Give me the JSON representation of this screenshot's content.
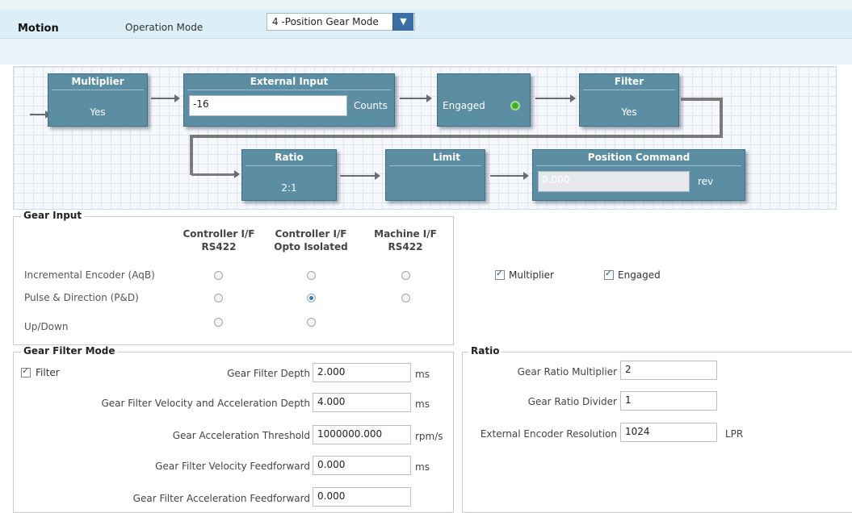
{
  "header": {
    "title": "Motion",
    "operation_mode_label": "Operation Mode",
    "operation_mode_value": "4 -Position Gear Mode"
  },
  "diagram": {
    "multiplier": {
      "title": "Multiplier",
      "value": "Yes"
    },
    "external_input": {
      "title": "External Input",
      "value": "-16",
      "unit": "Counts"
    },
    "engaged": {
      "label": "Engaged",
      "status_color": "#3fae2a"
    },
    "filter": {
      "title": "Filter",
      "value": "Yes"
    },
    "ratio": {
      "title": "Ratio",
      "value": "2:1"
    },
    "limit": {
      "title": "Limit"
    },
    "position_command": {
      "title": "Position Command",
      "value": "0.000",
      "unit": "rev"
    }
  },
  "gear_input": {
    "title": "Gear Input",
    "columns": [
      {
        "line1": "Controller I/F",
        "line2": "RS422"
      },
      {
        "line1": "Controller I/F",
        "line2": "Opto Isolated"
      },
      {
        "line1": "Machine I/F",
        "line2": "RS422"
      }
    ],
    "rows": [
      {
        "label": "Incremental Encoder (AqB)"
      },
      {
        "label": "Pulse & Direction (P&D)"
      },
      {
        "label": "Up/Down"
      }
    ],
    "selected": "Pulse & Direction (P&D) / Controller I/F Opto Isolated"
  },
  "checkboxes": {
    "multiplier": "Multiplier",
    "engaged": "Engaged"
  },
  "gear_filter_mode": {
    "title": "Gear Filter Mode",
    "filter_checkbox": "Filter",
    "fields": [
      {
        "label": "Gear Filter Depth",
        "value": "2.000",
        "unit": "ms"
      },
      {
        "label": "Gear Filter Velocity and Acceleration Depth",
        "value": "4.000",
        "unit": "ms"
      },
      {
        "label": "Gear Acceleration Threshold",
        "value": "1000000.000",
        "unit": "rpm/s"
      },
      {
        "label": "Gear Filter Velocity Feedforward",
        "value": "0.000",
        "unit": "ms"
      },
      {
        "label": "Gear Filter Acceleration Feedforward",
        "value": "0.000",
        "unit": ""
      }
    ]
  },
  "ratio": {
    "title": "Ratio",
    "fields": [
      {
        "label": "Gear Ratio Multiplier",
        "value": "2",
        "unit": ""
      },
      {
        "label": "Gear Ratio Divider",
        "value": "1",
        "unit": ""
      },
      {
        "label": "External Encoder Resolution",
        "value": "1024",
        "unit": "LPR"
      }
    ]
  },
  "colors": {
    "block": "#5b8da3",
    "accent": "#3b6ea5"
  }
}
